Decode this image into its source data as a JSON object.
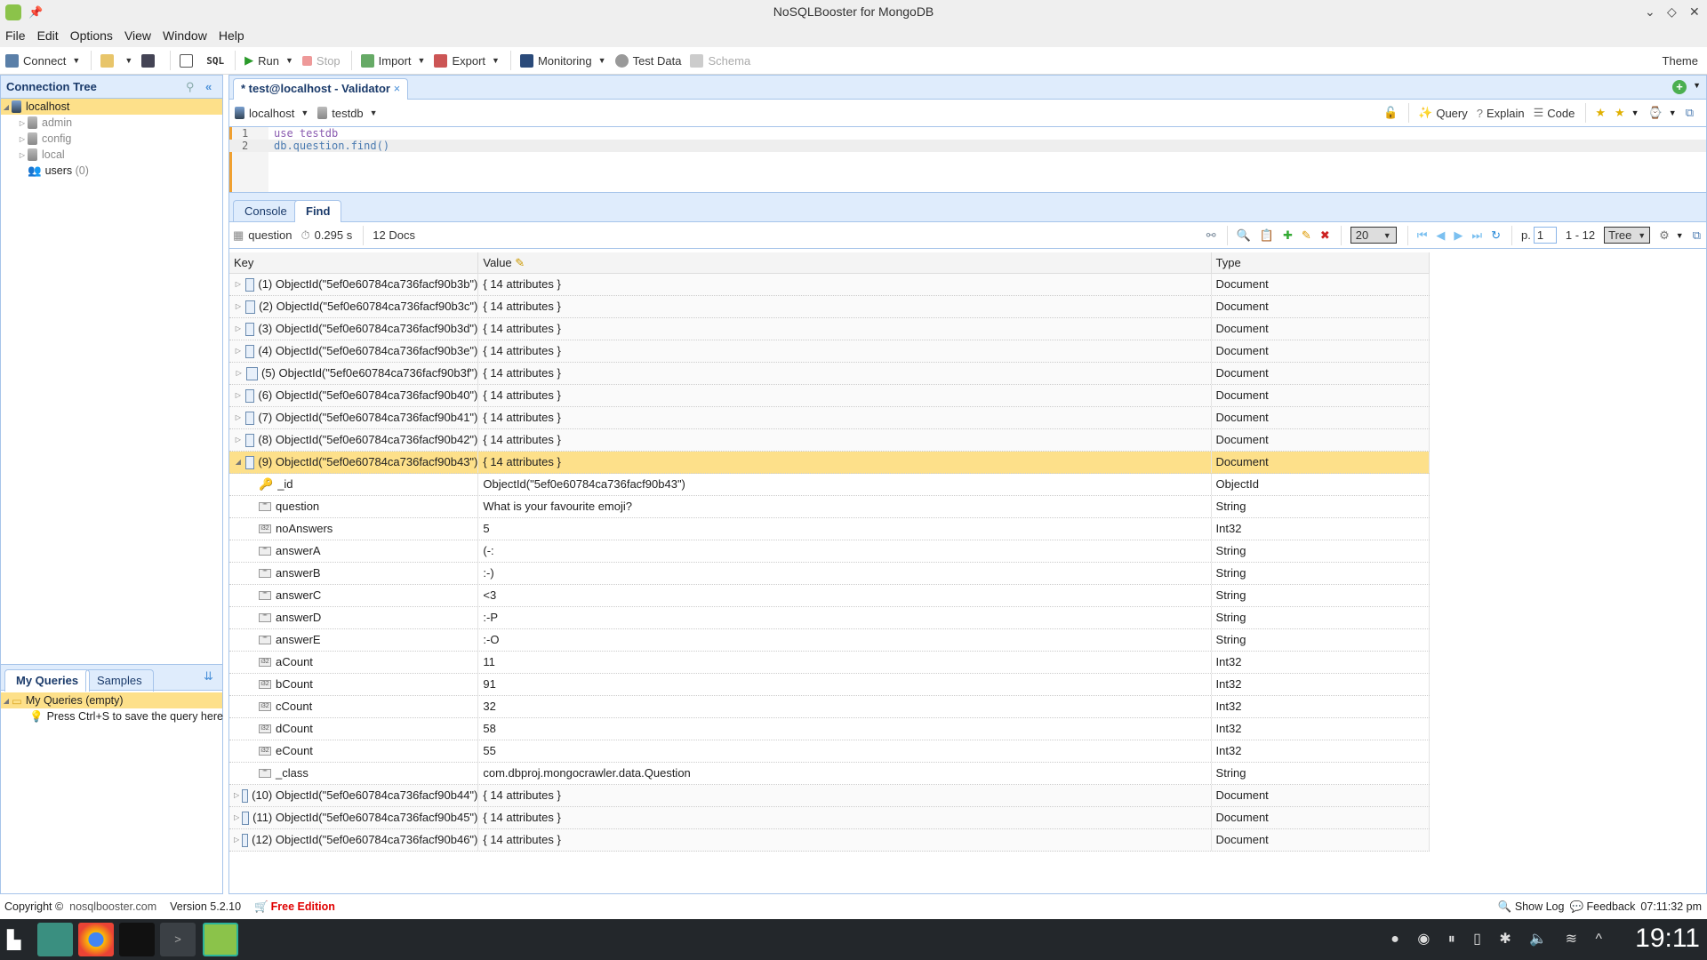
{
  "window": {
    "title": "NoSQLBooster for MongoDB"
  },
  "menu": [
    "File",
    "Edit",
    "Options",
    "View",
    "Window",
    "Help"
  ],
  "toolbar": {
    "connect": "Connect",
    "sql": "SQL",
    "run": "Run",
    "stop": "Stop",
    "import": "Import",
    "export": "Export",
    "monitoring": "Monitoring",
    "test_data": "Test Data",
    "schema": "Schema",
    "theme": "Theme"
  },
  "connection_tree": {
    "title": "Connection Tree",
    "items": [
      {
        "label": "localhost",
        "level": 0
      },
      {
        "label": "admin",
        "level": 1
      },
      {
        "label": "config",
        "level": 1
      },
      {
        "label": "local",
        "level": 1
      },
      {
        "label": "users",
        "count": "(0)",
        "level": 1
      }
    ]
  },
  "queries": {
    "tabs": [
      "My Queries",
      "Samples"
    ],
    "root": "My Queries (empty)",
    "hint": "Press Ctrl+S to save the query here"
  },
  "editor": {
    "tab_title": "* test@localhost - Validator",
    "connection": "localhost",
    "database": "testdb",
    "actions": {
      "query": "Query",
      "explain": "Explain",
      "code": "Code"
    },
    "lines": [
      "use testdb",
      "db.question.find()"
    ]
  },
  "results": {
    "tabs": [
      "Console",
      "Find"
    ],
    "active_tab": "Find",
    "collection": "question",
    "time": "0.295 s",
    "count": "12 Docs",
    "page_size": "20",
    "page_label": "p.",
    "page": "1",
    "range": "1 - 12",
    "view": "Tree",
    "columns": [
      "Key",
      "Value",
      "Type"
    ],
    "rows": [
      {
        "key": "(1) ObjectId(\"5ef0e60784ca736facf90b3b\")",
        "value": "{ 14 attributes }",
        "type": "Document"
      },
      {
        "key": "(2) ObjectId(\"5ef0e60784ca736facf90b3c\")",
        "value": "{ 14 attributes }",
        "type": "Document"
      },
      {
        "key": "(3) ObjectId(\"5ef0e60784ca736facf90b3d\")",
        "value": "{ 14 attributes }",
        "type": "Document"
      },
      {
        "key": "(4) ObjectId(\"5ef0e60784ca736facf90b3e\")",
        "value": "{ 14 attributes }",
        "type": "Document"
      },
      {
        "key": "(5) ObjectId(\"5ef0e60784ca736facf90b3f\")",
        "value": "{ 14 attributes }",
        "type": "Document"
      },
      {
        "key": "(6) ObjectId(\"5ef0e60784ca736facf90b40\")",
        "value": "{ 14 attributes }",
        "type": "Document"
      },
      {
        "key": "(7) ObjectId(\"5ef0e60784ca736facf90b41\")",
        "value": "{ 14 attributes }",
        "type": "Document"
      },
      {
        "key": "(8) ObjectId(\"5ef0e60784ca736facf90b42\")",
        "value": "{ 14 attributes }",
        "type": "Document"
      },
      {
        "key": "(9) ObjectId(\"5ef0e60784ca736facf90b43\")",
        "value": "{ 14 attributes }",
        "type": "Document",
        "expanded": true,
        "selected": true
      },
      {
        "key": "_id",
        "value": "ObjectId(\"5ef0e60784ca736facf90b43\")",
        "type": "ObjectId",
        "child": true,
        "icon": "key-icon"
      },
      {
        "key": "question",
        "value": "What is your favourite emoji?",
        "type": "String",
        "child": true,
        "icon": "string-icon"
      },
      {
        "key": "noAnswers",
        "value": "5",
        "type": "Int32",
        "child": true,
        "icon": "int32-icon"
      },
      {
        "key": "answerA",
        "value": "(-:",
        "type": "String",
        "child": true,
        "icon": "string-icon"
      },
      {
        "key": "answerB",
        "value": ":-)",
        "type": "String",
        "child": true,
        "icon": "string-icon"
      },
      {
        "key": "answerC",
        "value": "<3",
        "type": "String",
        "child": true,
        "icon": "string-icon"
      },
      {
        "key": "answerD",
        "value": ":-P",
        "type": "String",
        "child": true,
        "icon": "string-icon"
      },
      {
        "key": "answerE",
        "value": ":-O",
        "type": "String",
        "child": true,
        "icon": "string-icon"
      },
      {
        "key": "aCount",
        "value": "11",
        "type": "Int32",
        "child": true,
        "icon": "int32-icon"
      },
      {
        "key": "bCount",
        "value": "91",
        "type": "Int32",
        "child": true,
        "icon": "int32-icon"
      },
      {
        "key": "cCount",
        "value": "32",
        "type": "Int32",
        "child": true,
        "icon": "int32-icon"
      },
      {
        "key": "dCount",
        "value": "58",
        "type": "Int32",
        "child": true,
        "icon": "int32-icon"
      },
      {
        "key": "eCount",
        "value": "55",
        "type": "Int32",
        "child": true,
        "icon": "int32-icon"
      },
      {
        "key": "_class",
        "value": "com.dbproj.mongocrawler.data.Question",
        "type": "String",
        "child": true,
        "icon": "string-icon"
      },
      {
        "key": "(10) ObjectId(\"5ef0e60784ca736facf90b44\")",
        "value": "{ 14 attributes }",
        "type": "Document"
      },
      {
        "key": "(11) ObjectId(\"5ef0e60784ca736facf90b45\")",
        "value": "{ 14 attributes }",
        "type": "Document"
      },
      {
        "key": "(12) ObjectId(\"5ef0e60784ca736facf90b46\")",
        "value": "{ 14 attributes }",
        "type": "Document"
      }
    ]
  },
  "status": {
    "copyright": "Copyright ©",
    "site": "nosqlbooster.com",
    "version": "Version 5.2.10",
    "edition": "Free Edition",
    "show_log": "Show Log",
    "feedback": "Feedback",
    "time": "07:11:32 pm"
  },
  "taskbar": {
    "clock": "19:11"
  },
  "colors": {
    "selection": "#fde08a",
    "panel_header": "#dfecfc",
    "border": "#a6c4ea",
    "edition": "#e00000"
  }
}
